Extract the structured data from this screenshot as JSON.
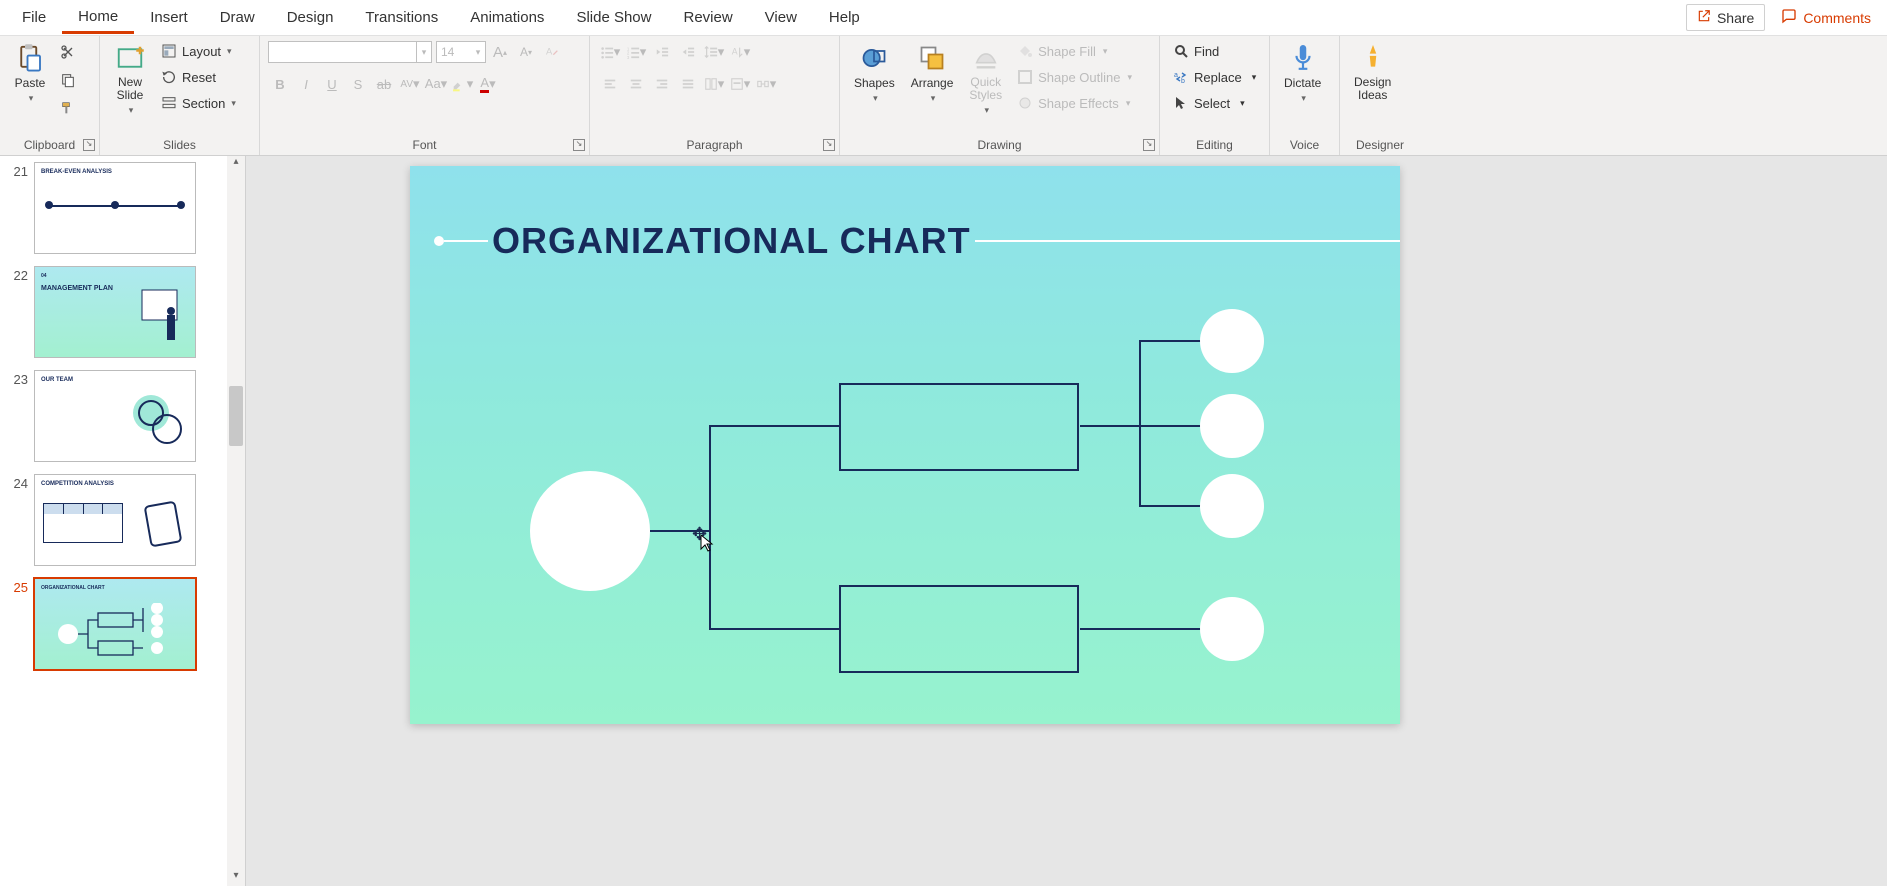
{
  "menu": {
    "tabs": [
      "File",
      "Home",
      "Insert",
      "Draw",
      "Design",
      "Transitions",
      "Animations",
      "Slide Show",
      "Review",
      "View",
      "Help"
    ],
    "active": "Home",
    "share": "Share",
    "comments": "Comments"
  },
  "ribbon": {
    "clipboard": {
      "paste": "Paste",
      "label": "Clipboard"
    },
    "slides": {
      "new_slide": "New\nSlide",
      "layout": "Layout",
      "reset": "Reset",
      "section": "Section",
      "label": "Slides"
    },
    "font": {
      "size": "14",
      "label": "Font"
    },
    "paragraph": {
      "label": "Paragraph"
    },
    "drawing": {
      "shapes": "Shapes",
      "arrange": "Arrange",
      "quick_styles": "Quick\nStyles",
      "fill": "Shape Fill",
      "outline": "Shape Outline",
      "effects": "Shape Effects",
      "label": "Drawing"
    },
    "editing": {
      "find": "Find",
      "replace": "Replace",
      "select": "Select",
      "label": "Editing"
    },
    "voice": {
      "dictate": "Dictate",
      "label": "Voice"
    },
    "designer": {
      "design_ideas": "Design\nIdeas",
      "label": "Designer"
    }
  },
  "thumbs": [
    {
      "num": "21",
      "title": "BREAK-EVEN ANALYSIS",
      "theme": "white"
    },
    {
      "num": "22",
      "title": "MANAGEMENT PLAN",
      "subtitle": "04",
      "theme": "grad"
    },
    {
      "num": "23",
      "title": "OUR TEAM",
      "theme": "white"
    },
    {
      "num": "24",
      "title": "COMPETITION ANALYSIS",
      "theme": "white"
    },
    {
      "num": "25",
      "title": "ORGANIZATIONAL CHART",
      "theme": "grad",
      "active": true
    }
  ],
  "slide": {
    "title": "ORGANIZATIONAL CHART"
  }
}
